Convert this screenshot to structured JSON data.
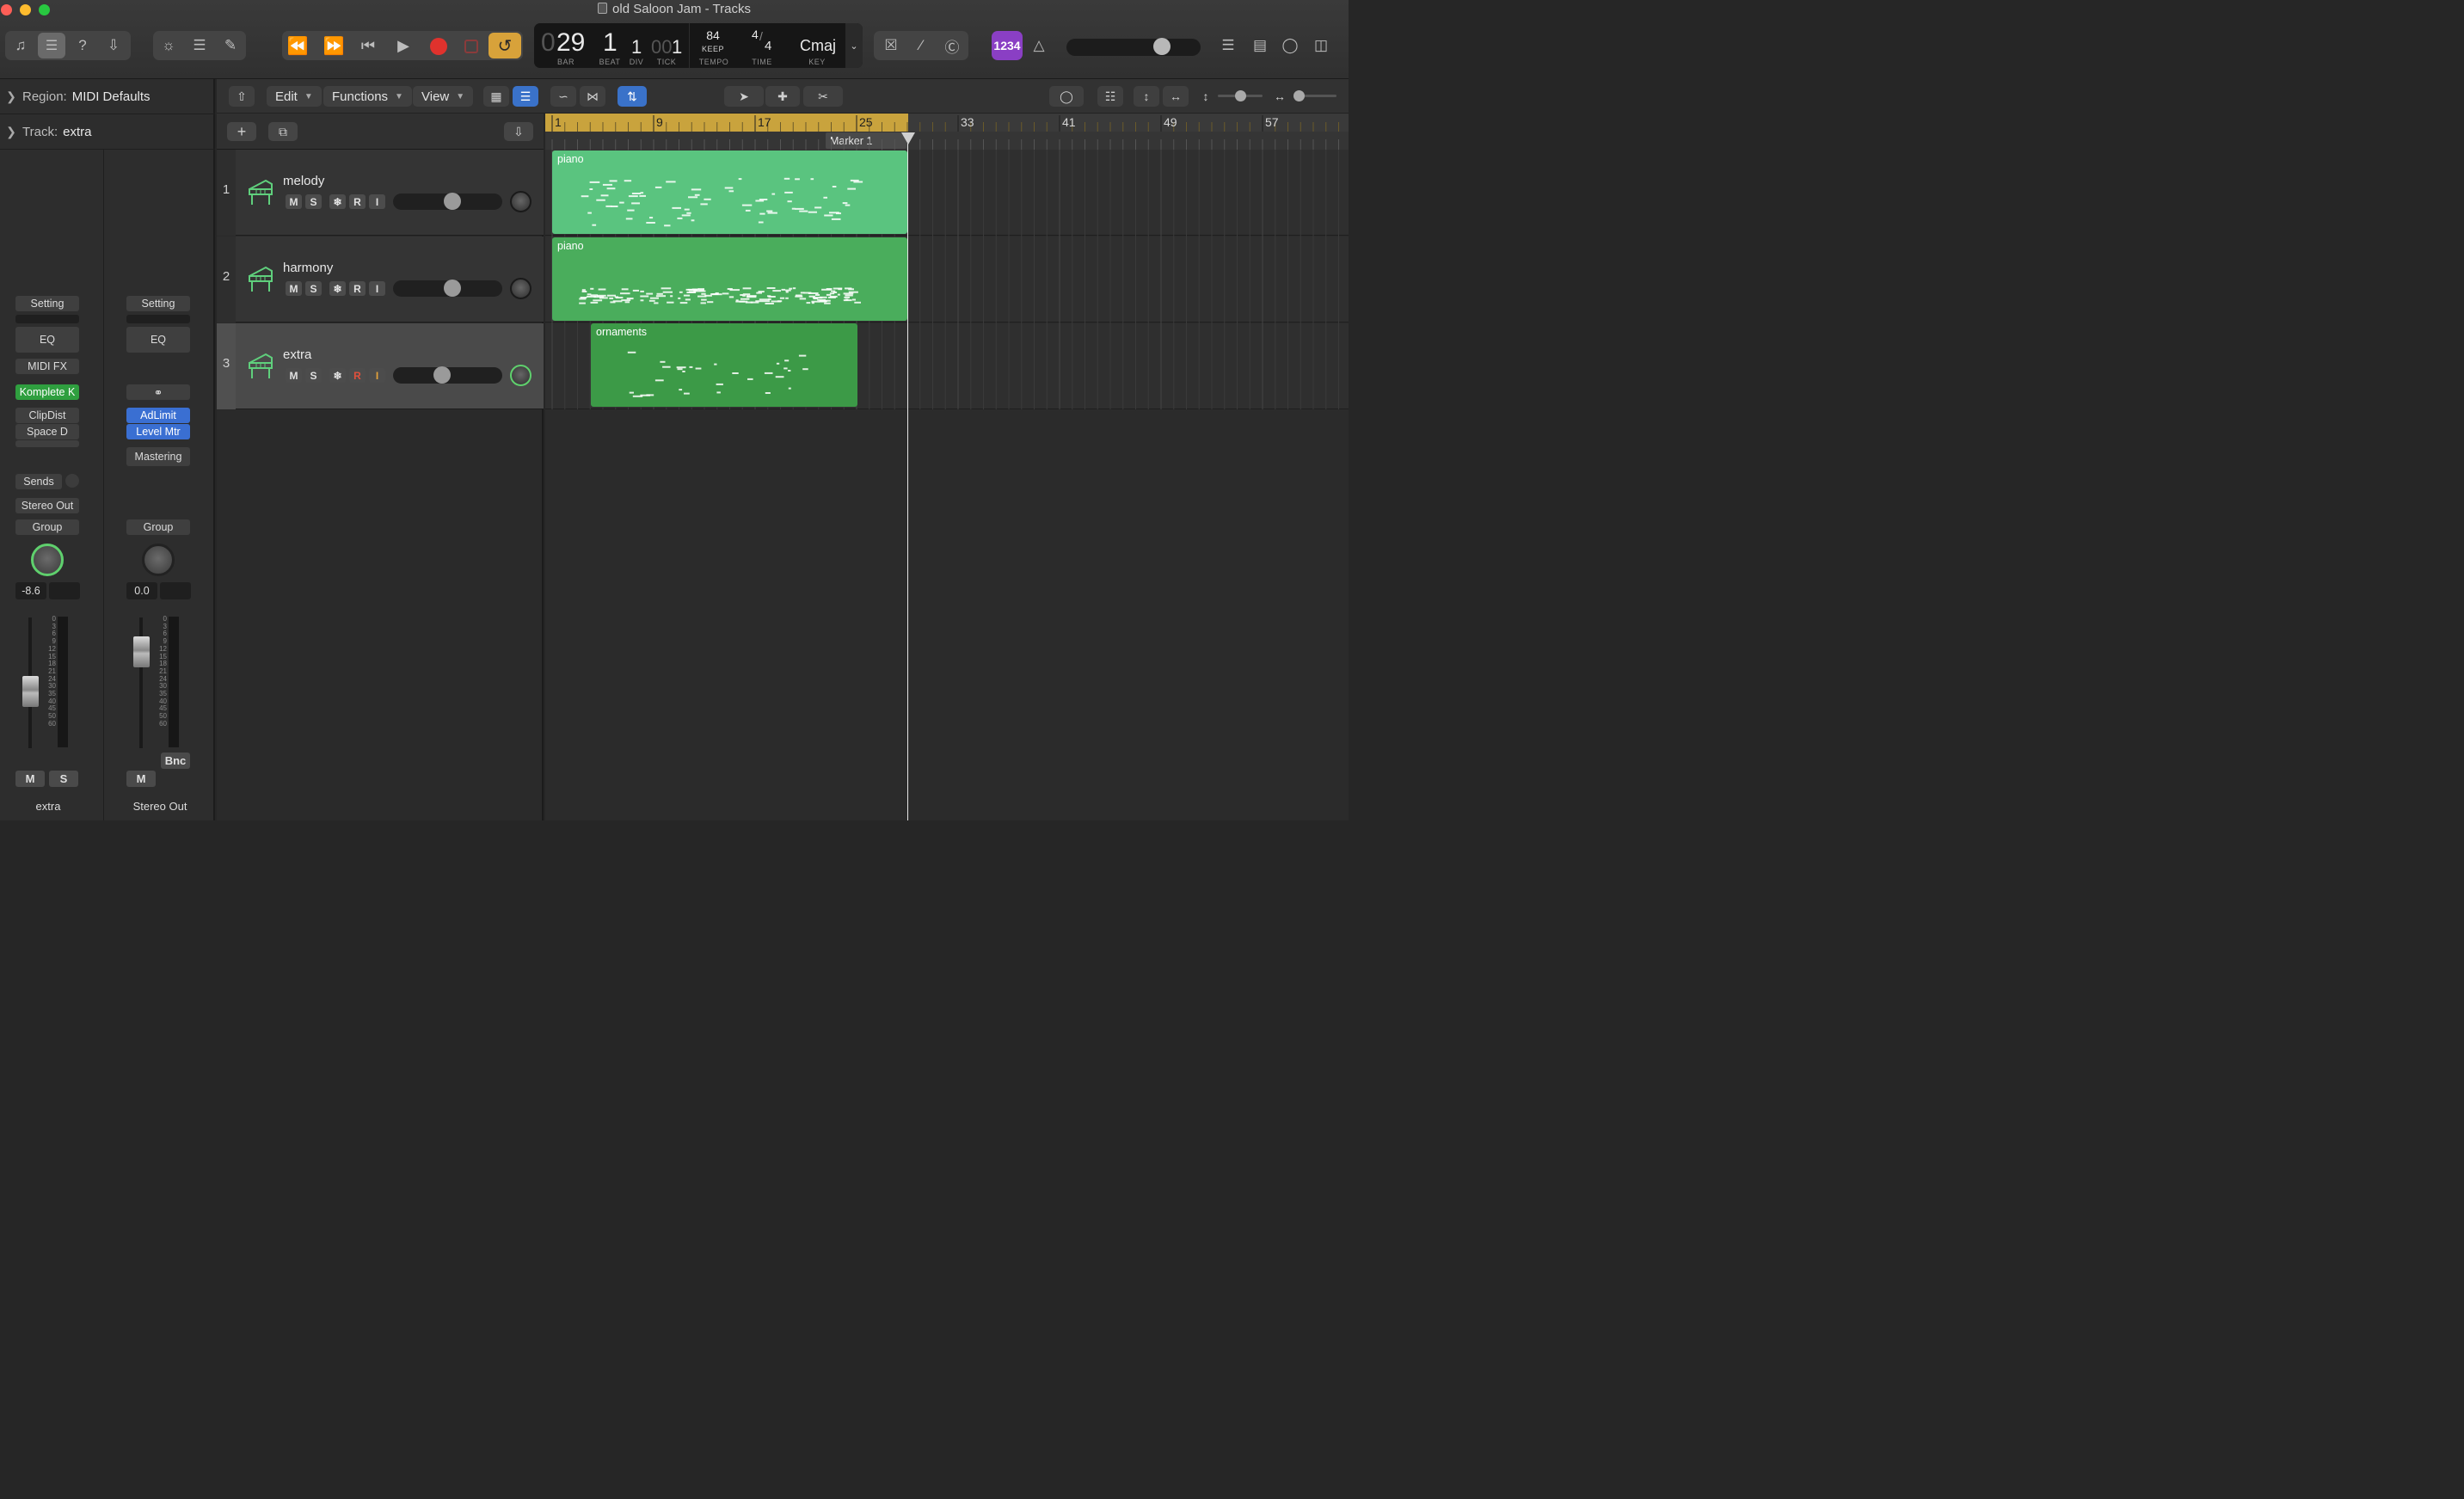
{
  "window": {
    "title": "old Saloon Jam - Tracks",
    "traffic_colors": [
      "#fe5f57",
      "#febc2e",
      "#28c840"
    ]
  },
  "lcd": {
    "bar_lead": "0",
    "bar": "29",
    "beat": "1",
    "div": "1",
    "tick_lead": "00",
    "tick": "1",
    "bar_label": "BAR",
    "beat_label": "BEAT",
    "div_label": "DIV",
    "tick_label": "TICK",
    "tempo": "84",
    "tempo_mode": "KEEP",
    "tempo_label": "TEMPO",
    "time_num": "4",
    "time_den": "4",
    "time_label": "TIME",
    "key": "Cmaj",
    "key_label": "KEY"
  },
  "count_in_label": "1234",
  "master_volume_fraction": 0.74,
  "inspector": {
    "region_label": "Region:",
    "region_value": "MIDI Defaults",
    "track_label": "Track:",
    "track_value": "extra",
    "strip1": {
      "setting": "Setting",
      "eq": "EQ",
      "midi_fx": "MIDI FX",
      "instrument": "Komplete K",
      "insert1": "ClipDist",
      "insert2": "Space D",
      "sends": "Sends",
      "output": "Stereo Out",
      "group": "Group",
      "volume": "-8.6",
      "mute": "M",
      "solo": "S",
      "name": "extra"
    },
    "strip2": {
      "setting": "Setting",
      "eq": "EQ",
      "insert1": "AdLimit",
      "insert2": "Level Mtr",
      "mastering": "Mastering",
      "group": "Group",
      "volume": "0.0",
      "bnc": "Bnc",
      "mute": "M",
      "name": "Stereo Out"
    },
    "meter_scale": [
      "0",
      "3",
      "6",
      "9",
      "12",
      "15",
      "18",
      "21",
      "24",
      "30",
      "35",
      "40",
      "45",
      "50",
      "60"
    ]
  },
  "toolbar": {
    "edit": "Edit",
    "functions": "Functions",
    "view": "View"
  },
  "tracks": [
    {
      "num": "1",
      "name": "melody",
      "mute": "M",
      "solo": "S",
      "freeze": "❄",
      "rec": "R",
      "input": "I",
      "volume_fraction": 0.55
    },
    {
      "num": "2",
      "name": "harmony",
      "mute": "M",
      "solo": "S",
      "freeze": "❄",
      "rec": "R",
      "input": "I",
      "volume_fraction": 0.55
    },
    {
      "num": "3",
      "name": "extra",
      "mute": "M",
      "solo": "S",
      "freeze": "❄",
      "rec": "R",
      "input": "I",
      "volume_fraction": 0.44
    }
  ],
  "ruler": {
    "bars": [
      "1",
      "9",
      "17",
      "25",
      "33",
      "41",
      "49",
      "57"
    ],
    "marker": "Marker 1"
  },
  "regions": [
    {
      "name": "piano",
      "track": 1,
      "color": "#5ac47f"
    },
    {
      "name": "piano",
      "track": 2,
      "color": "#4aad5c"
    },
    {
      "name": "ornaments",
      "track": 3,
      "color": "#3c9a47"
    }
  ]
}
